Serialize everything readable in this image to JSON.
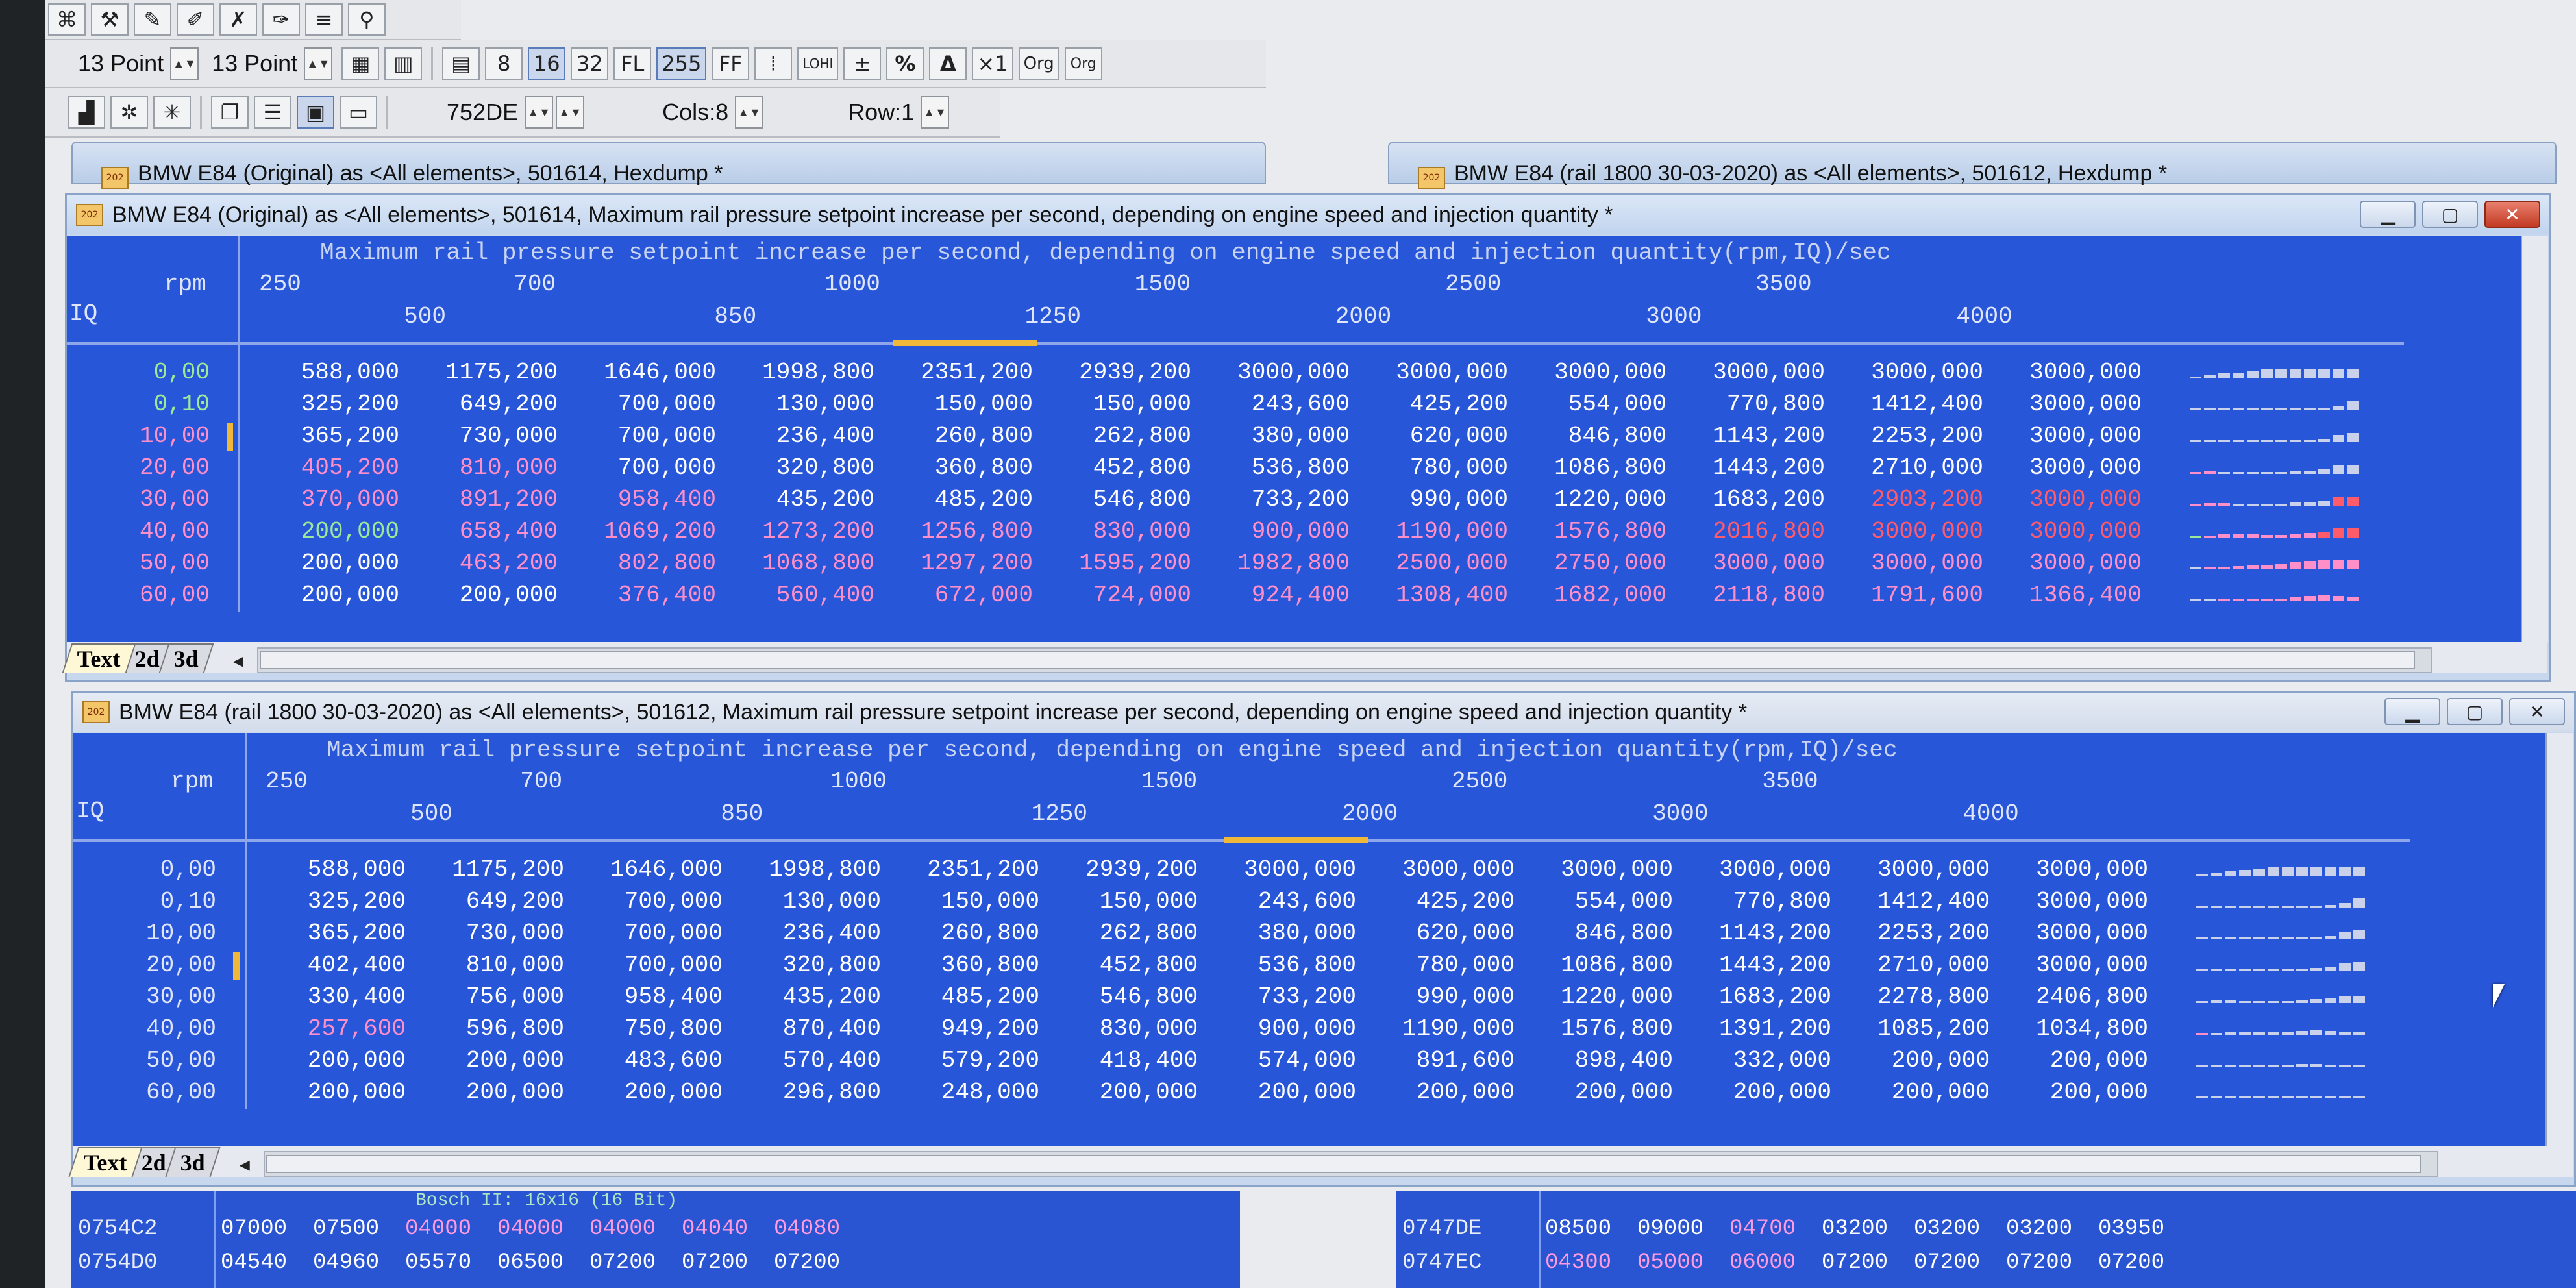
{
  "toolbar": {
    "font1": "13 Point",
    "font2": "13 Point",
    "row1_buttons": [
      "8",
      "16",
      "32",
      "FL",
      "255",
      "FF",
      "LOHI",
      "%",
      "Δ",
      "×1",
      "Org",
      "Org"
    ],
    "address": "752DE",
    "cols": "Cols:8",
    "row": "Row:1"
  },
  "back_windows": [
    {
      "title": "BMW E84 (Original) as <All elements>, 501614, Hexdump *"
    },
    {
      "title": "BMW E84 (rail 1800 30-03-2020) as <All elements>, 501612, Hexdump *"
    }
  ],
  "window1": {
    "title": "BMW E84 (Original) as <All elements>, 501614, Maximum rail pressure setpoint increase per second, depending on engine speed and injection quantity *",
    "map_title": "Maximum rail pressure setpoint increase per second, depending on engine speed and injection quantity(rpm,IQ)/sec",
    "x_axis_label": "rpm",
    "y_axis_label": "IQ",
    "rpm": [
      "250",
      "500",
      "700",
      "850",
      "1000",
      "1250",
      "1500",
      "2000",
      "2500",
      "3000",
      "3500",
      "4000"
    ],
    "iq": [
      "0,00",
      "0,10",
      "10,00",
      "20,00",
      "30,00",
      "40,00",
      "50,00",
      "60,00"
    ],
    "rows": [
      [
        "588,000",
        "1175,200",
        "1646,000",
        "1998,800",
        "2351,200",
        "2939,200",
        "3000,000",
        "3000,000",
        "3000,000",
        "3000,000",
        "3000,000",
        "3000,000"
      ],
      [
        "325,200",
        "649,200",
        "700,000",
        "130,000",
        "150,000",
        "150,000",
        "243,600",
        "425,200",
        "554,000",
        "770,800",
        "1412,400",
        "3000,000"
      ],
      [
        "365,200",
        "730,000",
        "700,000",
        "236,400",
        "260,800",
        "262,800",
        "380,000",
        "620,000",
        "846,800",
        "1143,200",
        "2253,200",
        "3000,000"
      ],
      [
        "405,200",
        "810,000",
        "700,000",
        "320,800",
        "360,800",
        "452,800",
        "536,800",
        "780,000",
        "1086,800",
        "1443,200",
        "2710,000",
        "3000,000"
      ],
      [
        "370,000",
        "891,200",
        "958,400",
        "435,200",
        "485,200",
        "546,800",
        "733,200",
        "990,000",
        "1220,000",
        "1683,200",
        "2903,200",
        "3000,000"
      ],
      [
        "200,000",
        "658,400",
        "1069,200",
        "1273,200",
        "1256,800",
        "830,000",
        "900,000",
        "1190,000",
        "1576,800",
        "2016,800",
        "3000,000",
        "3000,000"
      ],
      [
        "200,000",
        "463,200",
        "802,800",
        "1068,800",
        "1297,200",
        "1595,200",
        "1982,800",
        "2500,000",
        "2750,000",
        "3000,000",
        "3000,000",
        "3000,000"
      ],
      [
        "200,000",
        "200,000",
        "376,400",
        "560,400",
        "672,000",
        "724,000",
        "924,400",
        "1308,400",
        "1682,000",
        "2118,800",
        "1791,600",
        "1366,400"
      ]
    ],
    "tabs": [
      "Text",
      "2d",
      "3d"
    ]
  },
  "window2": {
    "title": "BMW E84 (rail 1800 30-03-2020) as <All elements>, 501612, Maximum rail pressure setpoint increase per second, depending on engine speed and injection quantity *",
    "map_title": "Maximum rail pressure setpoint increase per second, depending on engine speed and injection quantity(rpm,IQ)/sec",
    "x_axis_label": "rpm",
    "y_axis_label": "IQ",
    "rpm": [
      "250",
      "500",
      "700",
      "850",
      "1000",
      "1250",
      "1500",
      "2000",
      "2500",
      "3000",
      "3500",
      "4000"
    ],
    "iq": [
      "0,00",
      "0,10",
      "10,00",
      "20,00",
      "30,00",
      "40,00",
      "50,00",
      "60,00"
    ],
    "rows": [
      [
        "588,000",
        "1175,200",
        "1646,000",
        "1998,800",
        "2351,200",
        "2939,200",
        "3000,000",
        "3000,000",
        "3000,000",
        "3000,000",
        "3000,000",
        "3000,000"
      ],
      [
        "325,200",
        "649,200",
        "700,000",
        "130,000",
        "150,000",
        "150,000",
        "243,600",
        "425,200",
        "554,000",
        "770,800",
        "1412,400",
        "3000,000"
      ],
      [
        "365,200",
        "730,000",
        "700,000",
        "236,400",
        "260,800",
        "262,800",
        "380,000",
        "620,000",
        "846,800",
        "1143,200",
        "2253,200",
        "3000,000"
      ],
      [
        "402,400",
        "810,000",
        "700,000",
        "320,800",
        "360,800",
        "452,800",
        "536,800",
        "780,000",
        "1086,800",
        "1443,200",
        "2710,000",
        "3000,000"
      ],
      [
        "330,400",
        "756,000",
        "958,400",
        "435,200",
        "485,200",
        "546,800",
        "733,200",
        "990,000",
        "1220,000",
        "1683,200",
        "2278,800",
        "2406,800"
      ],
      [
        "257,600",
        "596,800",
        "750,800",
        "870,400",
        "949,200",
        "830,000",
        "900,000",
        "1190,000",
        "1576,800",
        "1391,200",
        "1085,200",
        "1034,800"
      ],
      [
        "200,000",
        "200,000",
        "483,600",
        "570,400",
        "579,200",
        "418,400",
        "574,000",
        "891,600",
        "898,400",
        "332,000",
        "200,000",
        "200,000"
      ],
      [
        "200,000",
        "200,000",
        "200,000",
        "296,800",
        "248,000",
        "200,000",
        "200,000",
        "200,000",
        "200,000",
        "200,000",
        "200,000",
        "200,000"
      ]
    ],
    "tabs": [
      "Text",
      "2d",
      "3d"
    ]
  },
  "hex_left": {
    "overlay_label": "Bosch II: 16x16 (16 Bit)",
    "rows": [
      {
        "addr": "0754C2",
        "values": [
          "07000",
          "07500",
          "04000",
          "04000",
          "04000",
          "04040",
          "04080"
        ]
      },
      {
        "addr": "0754D0",
        "values": [
          "04540",
          "04960",
          "05570",
          "06500",
          "07200",
          "07200",
          "07200"
        ]
      }
    ]
  },
  "hex_right": {
    "rows": [
      {
        "addr": "0747DE",
        "values": [
          "08500",
          "09000",
          "04700",
          "03200",
          "03200",
          "03200",
          "03950"
        ]
      },
      {
        "addr": "0747EC",
        "values": [
          "04300",
          "05000",
          "06000",
          "07200",
          "07200",
          "07200",
          "07200"
        ]
      }
    ]
  },
  "colors": {
    "map_bg": "#2856d8",
    "white": "#ffffff",
    "green": "#9ee89a",
    "pink": "#ff8fc8",
    "red": "#ff5b6b"
  }
}
